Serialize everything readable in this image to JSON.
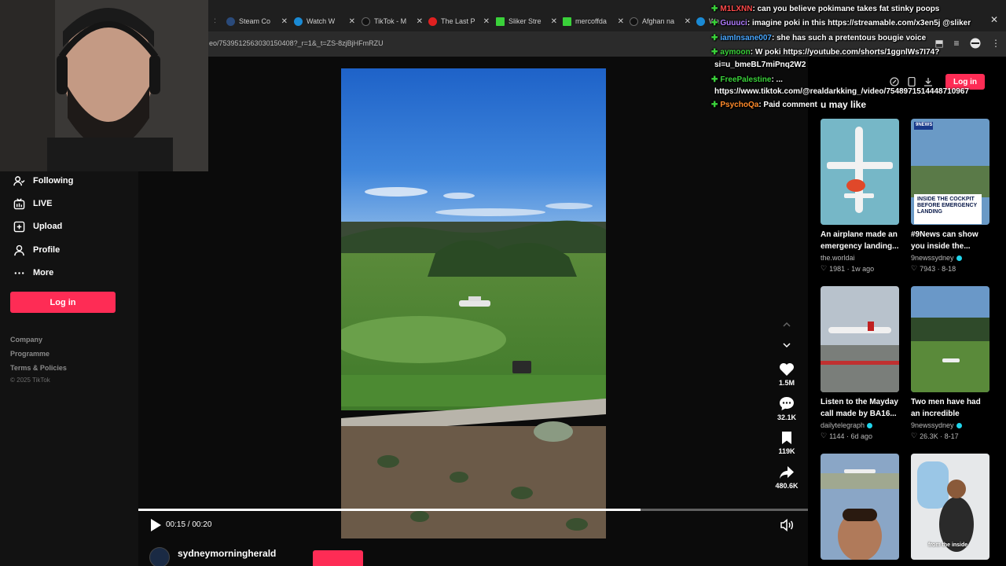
{
  "browser": {
    "tabs": [
      {
        "title": "Steam Co",
        "color": "#2a4a7a"
      },
      {
        "title": "Watch W",
        "color": "#1a8ad4"
      },
      {
        "title": "TikTok - M",
        "color": "#111111"
      },
      {
        "title": "The Last P",
        "color": "#e02020"
      },
      {
        "title": "Sliker Stre",
        "color": "#3ad13a"
      },
      {
        "title": "mercoffda",
        "color": "#3ad13a"
      },
      {
        "title": "Afghan na",
        "color": "#111111"
      },
      {
        "title": "Wa",
        "color": "#1a8ad4"
      }
    ],
    "url": "eo/7539512563030150408?_r=1&_t=ZS-8zjBjHFmRZU"
  },
  "sidebar": {
    "items": [
      {
        "label": "Following",
        "icon": "following-icon"
      },
      {
        "label": "LIVE",
        "icon": "live-icon"
      },
      {
        "label": "Upload",
        "icon": "upload-icon"
      },
      {
        "label": "Profile",
        "icon": "profile-icon"
      },
      {
        "label": "More",
        "icon": "more-icon"
      }
    ],
    "login_label": "Log in",
    "footer_links": [
      "Company",
      "Programme",
      "Terms & Policies"
    ],
    "copyright": "© 2025 TikTok"
  },
  "player": {
    "time": "00:15 / 00:20",
    "progress": 0.75,
    "author": "sydneymorningherald",
    "likes": "1.5M",
    "comments": "32.1K",
    "saves": "119K",
    "shares": "480.6K"
  },
  "header": {
    "login_label": "Log in"
  },
  "suggestions": {
    "heading": "u may like",
    "cards": [
      {
        "title": "An airplane made an emergency landing...",
        "author": "the.worldai",
        "verified": false,
        "likes": "1981",
        "age": "1w ago"
      },
      {
        "title": "#9News can show you inside the...",
        "author": "9newssydney",
        "verified": true,
        "likes": "7943",
        "age": "8-18",
        "thumb_caption": "INSIDE THE COCKPIT BEFORE EMERGENCY LANDING",
        "thumb_logo": "9NEWS"
      },
      {
        "title": "Listen to the Mayday call made by BA16...",
        "author": "dailytelegraph",
        "verified": true,
        "likes": "1144",
        "age": "6d ago"
      },
      {
        "title": "Two men have had an incredible escap...",
        "author": "9newssydney",
        "verified": true,
        "likes": "26.3K",
        "age": "8-17"
      },
      {
        "title": "",
        "author": "",
        "verified": false,
        "likes": "",
        "age": ""
      },
      {
        "title": "",
        "author": "",
        "verified": false,
        "likes": "",
        "age": "",
        "thumb_caption": "from the inside"
      }
    ]
  },
  "chat": {
    "messages": [
      {
        "user": "M1LXNN",
        "color": "#ff4a4a",
        "text": ": can you believe pokimane takes fat stinky poops"
      },
      {
        "user": "Guuuci",
        "color": "#b07cff",
        "text": ": imagine poki in this https://streamable.com/x3en5j @sliker"
      },
      {
        "user": "iamInsane007",
        "color": "#4aa8ff",
        "text": ": she has such a pretentous bougie voice"
      },
      {
        "user": "aymoon",
        "color": "#3ad13a",
        "text": ": W poki https://youtube.com/shorts/1ggnlWs7I74?"
      },
      {
        "user": "FreePalestine",
        "color": "#3ad13a",
        "text": ": ..."
      },
      {
        "user": "PsychoQa",
        "color": "#ff8a2a",
        "text": ": Paid comment"
      }
    ],
    "continuations": [
      "si=u_bmeBL7miPnq2W2",
      "https://www.tiktok.com/@realdarkking_/video/7548971514448710967"
    ]
  }
}
